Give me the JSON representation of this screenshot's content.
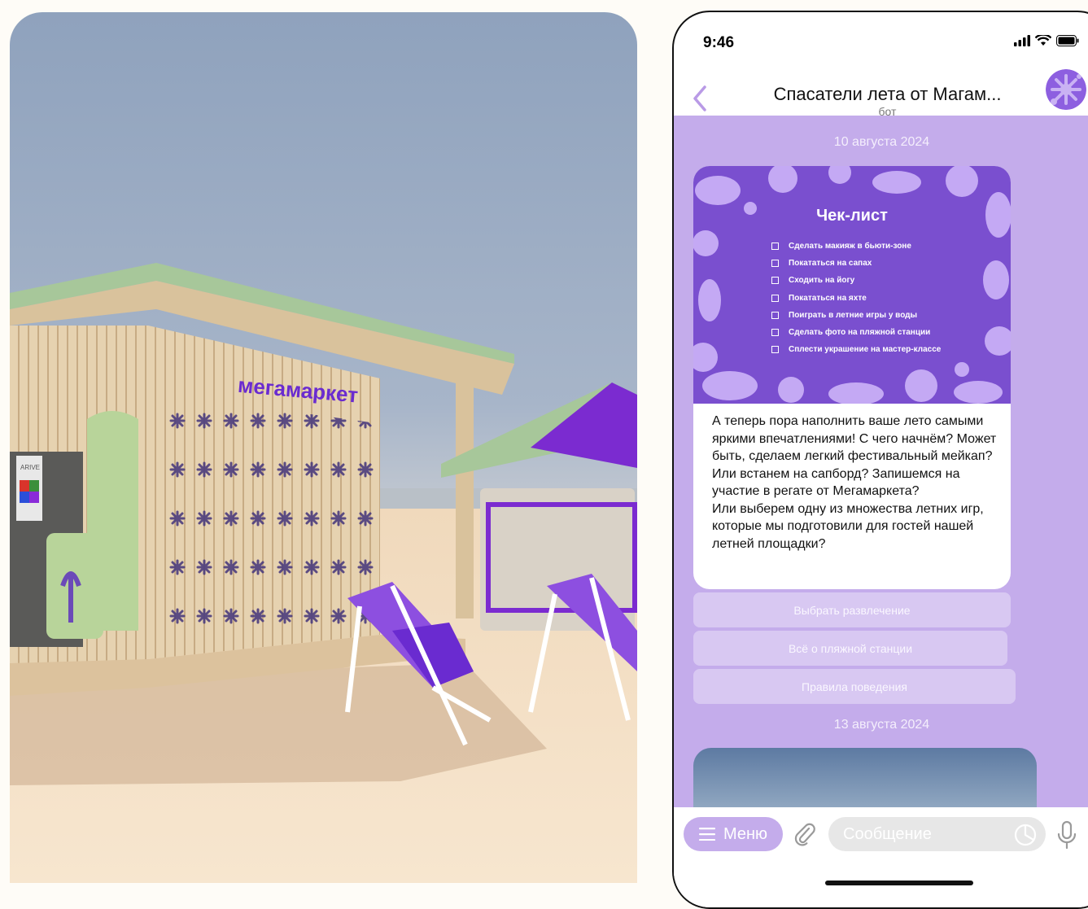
{
  "status_bar": {
    "time": "9:46"
  },
  "header": {
    "title": "Спасатели лета от Магам...",
    "subtitle": "бот"
  },
  "chat": {
    "date_1": "10 августа 2024",
    "date_2": "13 августа 2024",
    "checklist": {
      "title": "Чек-лист",
      "items": [
        "Сделать макияж в бьюти-зоне",
        "Покататься на сапах",
        "Сходить на йогу",
        "Покататься на яхте",
        "Поиграть в летние игры у воды",
        "Сделать фото на пляжной станции",
        "Сплести украшение на мастер-классе"
      ]
    },
    "message": {
      "paragraph_1": "А теперь пора наполнить ваше лето самыми яркими впечатлениями! С чего начнём? Может быть, сделаем легкий фестивальный мейкап? Или встанем на сапборд? Запишемся на участие в регате от Мегамаркета?",
      "paragraph_2": "Или выберем одну из множества летних игр, которые мы подготовили для гостей нашей летней площадки?"
    },
    "buttons": [
      "Выбрать развлечение",
      "Всё о пляжной станции",
      "Правила поведения"
    ]
  },
  "input_bar": {
    "menu_label": "Меню",
    "placeholder": "Сообщение"
  },
  "render": {
    "sign_text": "мегамаркет",
    "poster_text": "ARIVE"
  },
  "colors": {
    "accent": "#c4aceb",
    "brand_purple": "#7a4fcf"
  }
}
